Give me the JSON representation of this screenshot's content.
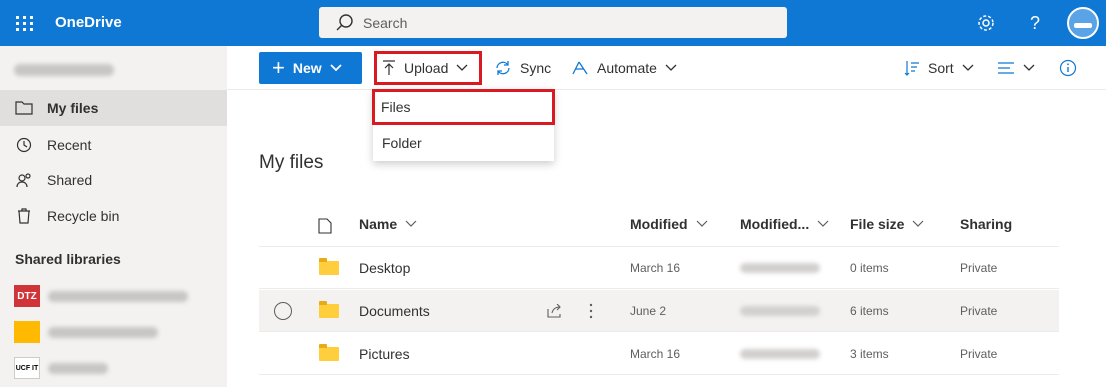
{
  "app": {
    "brand": "OneDrive"
  },
  "search": {
    "placeholder": "Search"
  },
  "topbar_icons": [
    "waffle-icon",
    "settings-icon",
    "help-icon",
    "avatar"
  ],
  "topbar": {
    "help_label": "?"
  },
  "sidebar": {
    "items": [
      {
        "label": "My files",
        "icon": "folder-icon",
        "active": true
      },
      {
        "label": "Recent",
        "icon": "history-icon"
      },
      {
        "label": "Shared",
        "icon": "shared-icon"
      },
      {
        "label": "Recycle bin",
        "icon": "recycle-bin-icon"
      }
    ],
    "section_label": "Shared libraries",
    "libraries": [
      {
        "logo_text": "DTZ",
        "logo_color": "#d13438"
      },
      {
        "logo_text": "",
        "logo_color": "#ffb900"
      },
      {
        "logo_text": "UCF IT",
        "logo_color": "#ffffff"
      }
    ]
  },
  "toolbar": {
    "new_label": "New",
    "upload_label": "Upload",
    "sync_label": "Sync",
    "automate_label": "Automate",
    "sort_label": "Sort"
  },
  "upload_menu": {
    "items": [
      "Files",
      "Folder"
    ]
  },
  "main": {
    "title": "My files",
    "columns": [
      "Name",
      "Modified",
      "Modified...",
      "File size",
      "Sharing"
    ],
    "rows": [
      {
        "name": "Desktop",
        "modified": "March 16",
        "file_size": "0 items",
        "sharing": "Private"
      },
      {
        "name": "Documents",
        "modified": "June 2",
        "file_size": "6 items",
        "sharing": "Private"
      },
      {
        "name": "Pictures",
        "modified": "March 16",
        "file_size": "3 items",
        "sharing": "Private"
      }
    ]
  },
  "colors": {
    "accent": "#0f78d4",
    "highlight": "#d91a23",
    "folder": "#ffce3d"
  }
}
